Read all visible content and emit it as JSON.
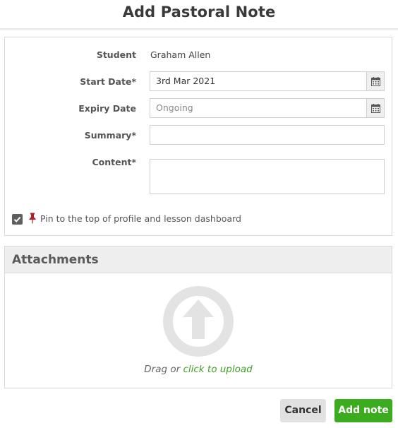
{
  "dialog": {
    "title": "Add Pastoral Note"
  },
  "form": {
    "student": {
      "label": "Student",
      "value": "Graham Allen"
    },
    "start_date": {
      "label": "Start Date",
      "required_mark": "*",
      "value": "3rd Mar 2021"
    },
    "expiry_date": {
      "label": "Expiry Date",
      "placeholder": "Ongoing"
    },
    "summary": {
      "label": "Summary",
      "required_mark": "*",
      "value": ""
    },
    "content": {
      "label": "Content",
      "required_mark": "*",
      "value": ""
    },
    "pin": {
      "checked": true,
      "label": "Pin to the top of profile and lesson dashboard",
      "icon": "pin-icon"
    }
  },
  "attachments": {
    "heading": "Attachments",
    "icon": "upload-icon",
    "drag_text": "Drag or",
    "link_text": "click to upload"
  },
  "actions": {
    "cancel_label": "Cancel",
    "add_label": "Add note"
  },
  "colors": {
    "primary_green": "#3aac1e",
    "link_green": "#3fa125",
    "pin_red": "#b01e23"
  }
}
